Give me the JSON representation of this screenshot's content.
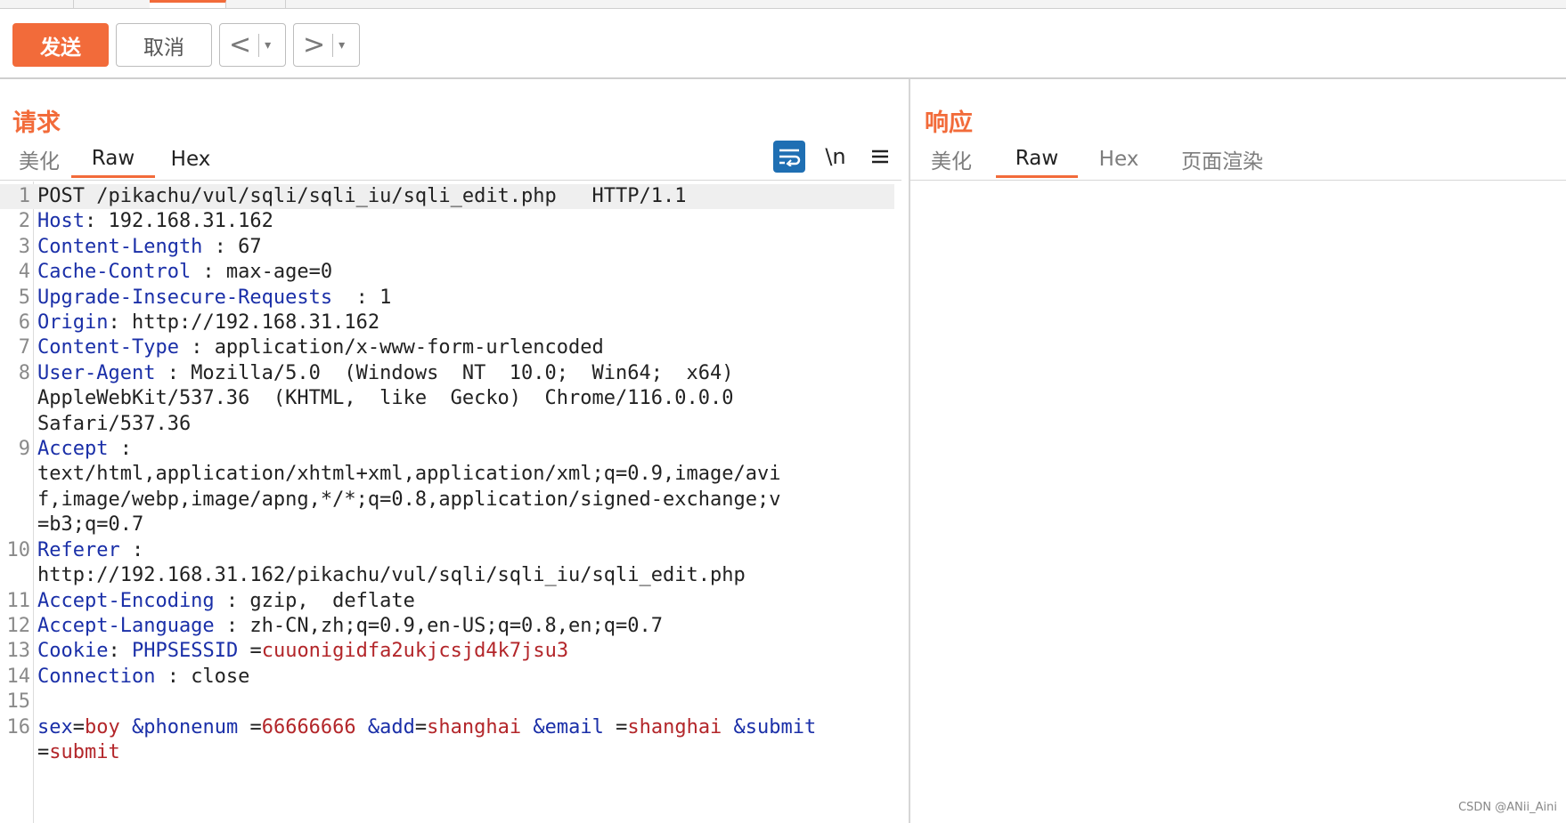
{
  "toolbar": {
    "send_label": "发送",
    "cancel_label": "取消",
    "back_arrow": "<",
    "forward_arrow": ">",
    "dropdown_caret": "▾"
  },
  "request": {
    "title": "请求",
    "tabs": [
      "美化",
      "Raw",
      "Hex"
    ],
    "active_tab": "Raw",
    "newline_toggle": "\\n",
    "lines": [
      {
        "n": "1",
        "text": "POST /pikachu/vul/sqli/sqli_iu/sqli_edit.php   HTTP/1.1"
      },
      {
        "n": "2",
        "key": "Host",
        "value": ": 192.168.31.162"
      },
      {
        "n": "3",
        "key": "Content-Length",
        "value": " : 67"
      },
      {
        "n": "4",
        "key": "Cache-Control",
        "value": " : max-age=0"
      },
      {
        "n": "5",
        "key": "Upgrade-Insecure-Requests",
        "value": "  : 1"
      },
      {
        "n": "6",
        "key": "Origin",
        "value": ": http://192.168.31.162"
      },
      {
        "n": "7",
        "key": "Content-Type",
        "value": " : application/x-www-form-urlencoded"
      },
      {
        "n": "8",
        "key": "User-Agent",
        "value": " : Mozilla/5.0  (Windows  NT  10.0;  Win64;  x64)"
      },
      {
        "n": "",
        "text": "AppleWebKit/537.36  (KHTML,  like  Gecko)  Chrome/116.0.0.0"
      },
      {
        "n": "",
        "text": "Safari/537.36"
      },
      {
        "n": "9",
        "key": "Accept",
        "value": " :"
      },
      {
        "n": "",
        "text": "text/html,application/xhtml+xml,application/xml;q=0.9,image/avi"
      },
      {
        "n": "",
        "text": "f,image/webp,image/apng,*/*;q=0.8,application/signed-exchange;v"
      },
      {
        "n": "",
        "text": "=b3;q=0.7"
      },
      {
        "n": "10",
        "key": "Referer",
        "value": " :"
      },
      {
        "n": "",
        "text": "http://192.168.31.162/pikachu/vul/sqli/sqli_iu/sqli_edit.php"
      },
      {
        "n": "11",
        "key": "Accept-Encoding",
        "value": " : gzip,  deflate"
      },
      {
        "n": "12",
        "key": "Accept-Language",
        "value": " : zh-CN,zh;q=0.9,en-US;q=0.8,en;q=0.7"
      },
      {
        "n": "13",
        "key": "Cookie",
        "value": ": ",
        "cookie_name": "PHPSESSID",
        "cookie_eq": " =",
        "cookie_value": "cuuonigidfa2ukjcsjd4k7jsu3"
      },
      {
        "n": "14",
        "key": "Connection",
        "value": " : close"
      },
      {
        "n": "15",
        "text": ""
      },
      {
        "n": "16",
        "body": [
          {
            "k": "sex",
            "eq": "=",
            "v": "boy"
          },
          {
            "k": " &phonenum",
            "eq": " =",
            "v": "66666666"
          },
          {
            "k": " &add",
            "eq": "=",
            "v": "shanghai"
          },
          {
            "k": " &email",
            "eq": " =",
            "v": "shanghai"
          },
          {
            "k": " &submit",
            "eq": " =",
            "v": "submit"
          }
        ]
      }
    ]
  },
  "response": {
    "title": "响应",
    "tabs": [
      "美化",
      "Raw",
      "Hex",
      "页面渲染"
    ],
    "active_tab": "Raw"
  },
  "watermark": "CSDN @ANii_Aini",
  "colors": {
    "accent": "#f26b3a",
    "header_key": "#1a2fa8",
    "param_value": "#b3262a",
    "icon_blue": "#1f6fb3"
  }
}
